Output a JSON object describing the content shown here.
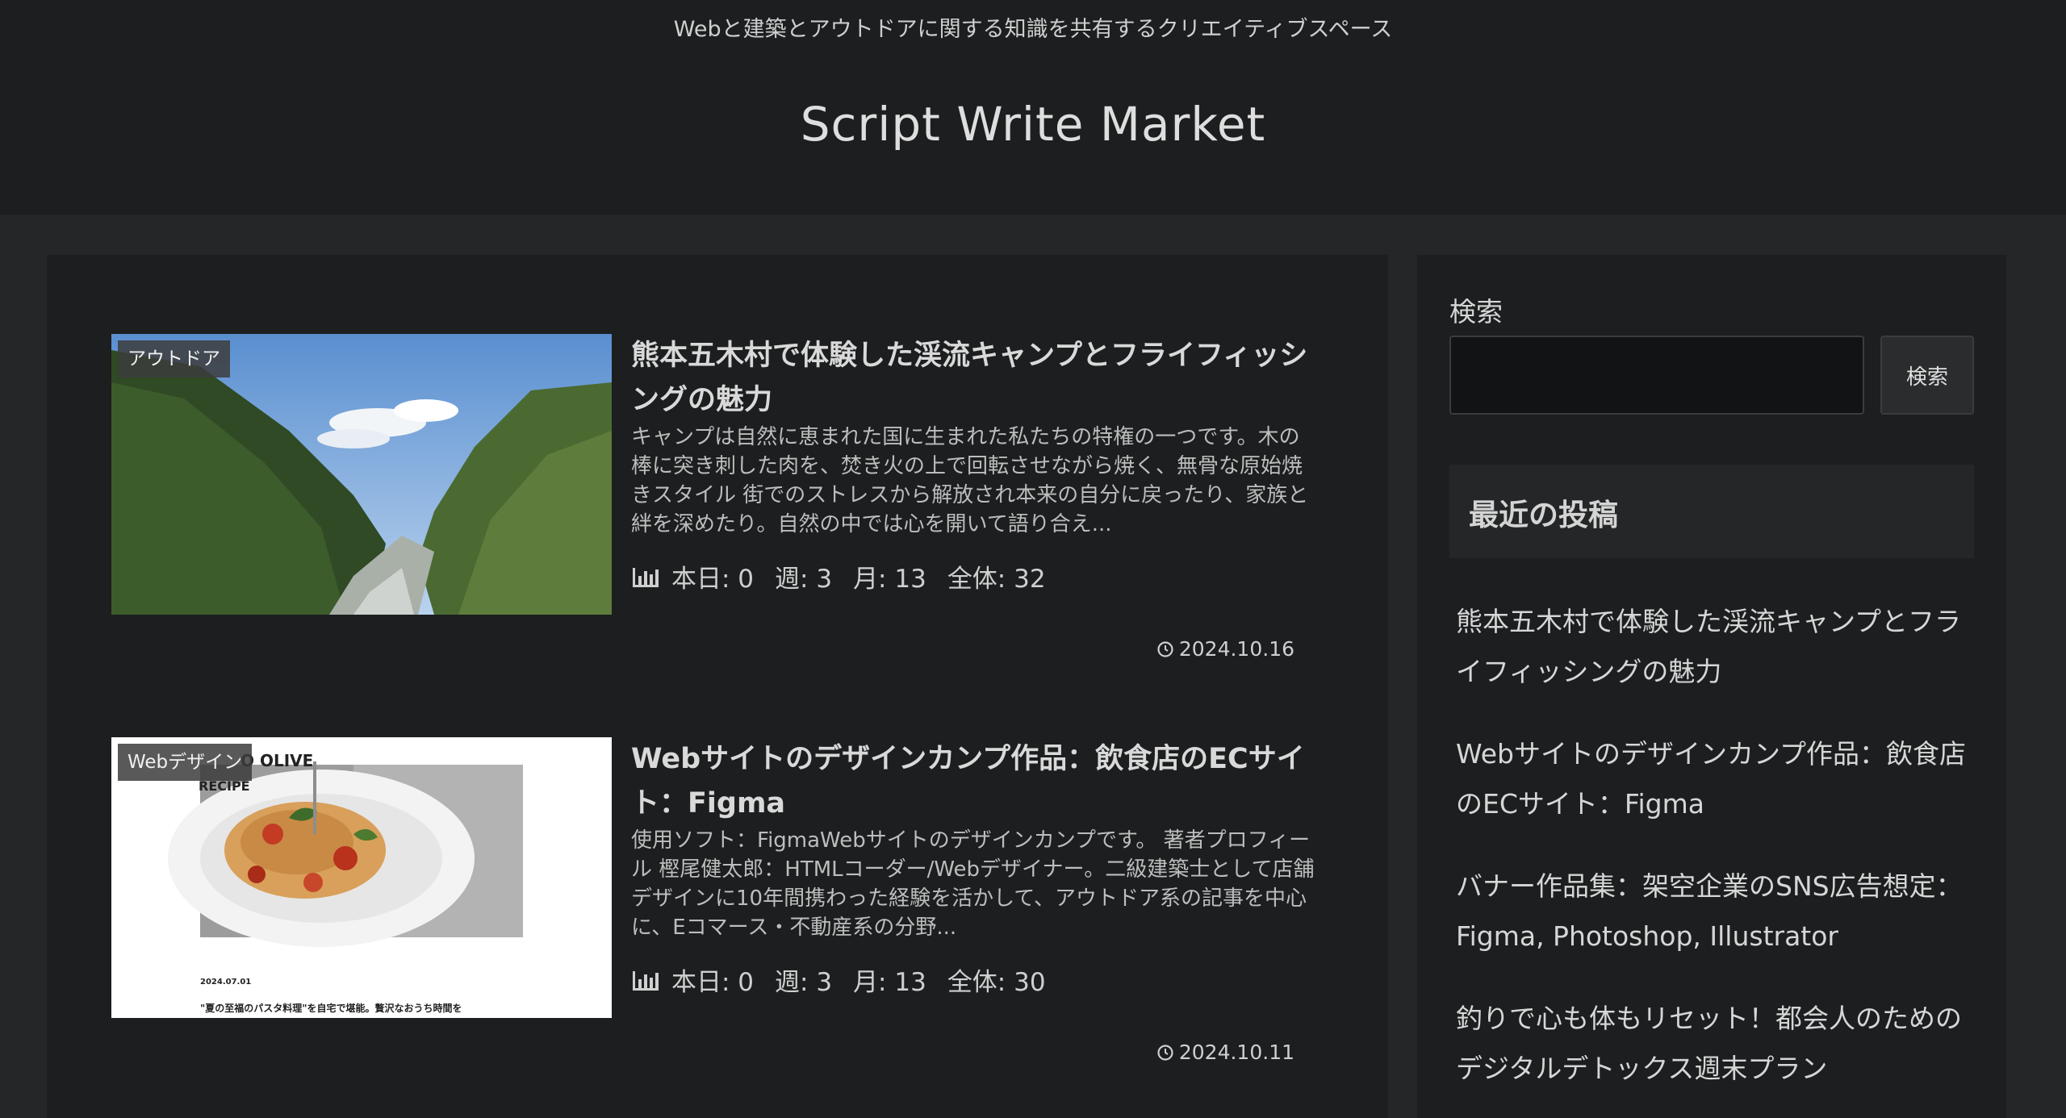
{
  "site": {
    "tagline": "Webと建築とアウトドアに関する知識を共有するクリエイティブスペース",
    "title": "Script Write Market"
  },
  "posts": [
    {
      "category": "アウトドア",
      "title": "熊本五木村で体験した渓流キャンプとフライフィッシングの魅力",
      "excerpt": "キャンプは自然に恵まれた国に生まれた私たちの特権の一つです。木の棒に突き刺した肉を、焚き火の上で回転させながら焼く、無骨な原始焼きスタイル 街でのストレスから解放され本来の自分に戻ったり、家族と絆を深めたり。自然の中では心を開いて語り合え...",
      "stats": {
        "today": "本日: 0",
        "week": "週: 3",
        "month": "月: 13",
        "total": "全体: 32"
      },
      "date": "2024.10.16",
      "thumb_icon": "mountain-valley-photo"
    },
    {
      "category": "Webデザイン",
      "title": "Webサイトのデザインカンプ作品：飲食店のECサイト：Figma",
      "excerpt": "使用ソフト：FigmaWebサイトのデザインカンプです。 著者プロフィール 樫尾健太郎：HTMLコーダー/Webデザイナー。二級建築士として店舗デザインに10年間携わった経験を活かして、アウトドア系の記事を中心に、Eコマース・不動産系の分野...",
      "stats": {
        "today": "本日: 0",
        "week": "週: 3",
        "month": "月: 13",
        "total": "全体: 30"
      },
      "date": "2024.10.11",
      "thumb_icon": "pasta-dish-photo",
      "thumb_text": {
        "brand": "O OLIVE",
        "sub": "RECIPE",
        "date": "2024.07.01",
        "caption": "\"夏の至福のパスタ料理\"を自宅で堪能。贅沢なおうち時間を"
      }
    }
  ],
  "sidebar": {
    "search_label": "検索",
    "search_placeholder": "",
    "search_button": "検索",
    "recent_heading": "最近の投稿",
    "recent_posts": [
      "熊本五木村で体験した渓流キャンプとフライフィッシングの魅力",
      "Webサイトのデザインカンプ作品：飲食店のECサイト：Figma",
      "バナー作品集：架空企業のSNS広告想定：Figma, Photoshop, Illustrator",
      "釣りで心も体もリセット！都会人のためのデジタルデトックス週末プラン"
    ]
  },
  "colors": {
    "page_bg": "#242627",
    "panel_bg": "#1c1e1f",
    "text": "#d6d6d6"
  }
}
